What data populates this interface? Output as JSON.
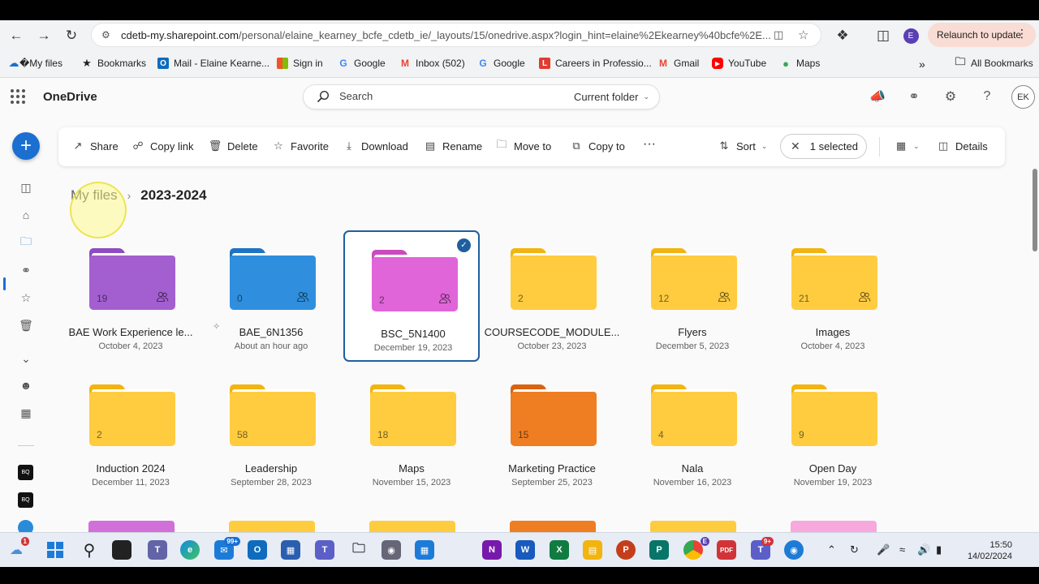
{
  "browser": {
    "url_host": "cdetb-my.sharepoint.com",
    "url_path": "/personal/elaine_kearney_bcfe_cdetb_ie/_layouts/15/onedrive.aspx?login_hint=elaine%2Ekearney%40bcfe%2E...",
    "profile_initial": "E",
    "relaunch_label": "Relaunch to update",
    "bookmarks": [
      "�My files",
      "Bookmarks",
      "Mail - Elaine Kearne...",
      "Sign in",
      "Google",
      "Inbox (502)",
      "Google",
      "Careers in Professio...",
      "Gmail",
      "YouTube",
      "Maps"
    ],
    "all_bookmarks_label": "All Bookmarks"
  },
  "app": {
    "brand": "OneDrive",
    "search_placeholder": "Search",
    "search_scope": "Current folder",
    "avatar_initials": "EK"
  },
  "commands": {
    "share": "Share",
    "copy_link": "Copy link",
    "delete": "Delete",
    "favorite": "Favorite",
    "download": "Download",
    "rename": "Rename",
    "move_to": "Move to",
    "copy_to": "Copy to",
    "more": "···",
    "sort": "Sort",
    "selected": "1 selected",
    "details": "Details"
  },
  "breadcrumb": {
    "root": "My files",
    "current": "2023-2024"
  },
  "folders": [
    {
      "name": "BAE Work Experience le...",
      "date": "October 4, 2023",
      "count": "19",
      "color": "#a35fd0",
      "tab": "#8e4cc0",
      "shared": true
    },
    {
      "name": "BAE_6N1356",
      "date": "About an hour ago",
      "count": "0",
      "color": "#2f8fde",
      "tab": "#1d74c4",
      "shared": true
    },
    {
      "name": "BSC_5N1400",
      "date": "December 19, 2023",
      "count": "2",
      "color": "#e065d8",
      "tab": "#c94bbf",
      "shared": true,
      "selected": true
    },
    {
      "name": "COURSECODE_MODULE...",
      "date": "October 23, 2023",
      "count": "2",
      "color": "#ffcc40",
      "tab": "#f2b40f",
      "shared": false
    },
    {
      "name": "Flyers",
      "date": "December 5, 2023",
      "count": "12",
      "color": "#ffcc40",
      "tab": "#f2b40f",
      "shared": true
    },
    {
      "name": "Images",
      "date": "October 4, 2023",
      "count": "21",
      "color": "#ffcc40",
      "tab": "#f2b40f",
      "shared": true
    },
    {
      "name": "Induction 2024",
      "date": "December 11, 2023",
      "count": "2",
      "color": "#ffcc40",
      "tab": "#f2b40f",
      "shared": false
    },
    {
      "name": "Leadership",
      "date": "September 28, 2023",
      "count": "58",
      "color": "#ffcc40",
      "tab": "#f2b40f",
      "shared": false
    },
    {
      "name": "Maps",
      "date": "November 15, 2023",
      "count": "18",
      "color": "#ffcc40",
      "tab": "#f2b40f",
      "shared": false
    },
    {
      "name": "Marketing Practice",
      "date": "September 25, 2023",
      "count": "15",
      "color": "#ef7d22",
      "tab": "#d9630f",
      "shared": false
    },
    {
      "name": "Nala",
      "date": "November 16, 2023",
      "count": "4",
      "color": "#ffcc40",
      "tab": "#f2b40f",
      "shared": false
    },
    {
      "name": "Open Day",
      "date": "November 19, 2023",
      "count": "9",
      "color": "#ffcc40",
      "tab": "#f2b40f",
      "shared": false
    }
  ],
  "taskbar": {
    "teams_badge": "99+",
    "mail_badge": "9+",
    "weather_badge": "1",
    "chrome_badge": "E",
    "time": "15:50",
    "date": "14/02/2024"
  }
}
